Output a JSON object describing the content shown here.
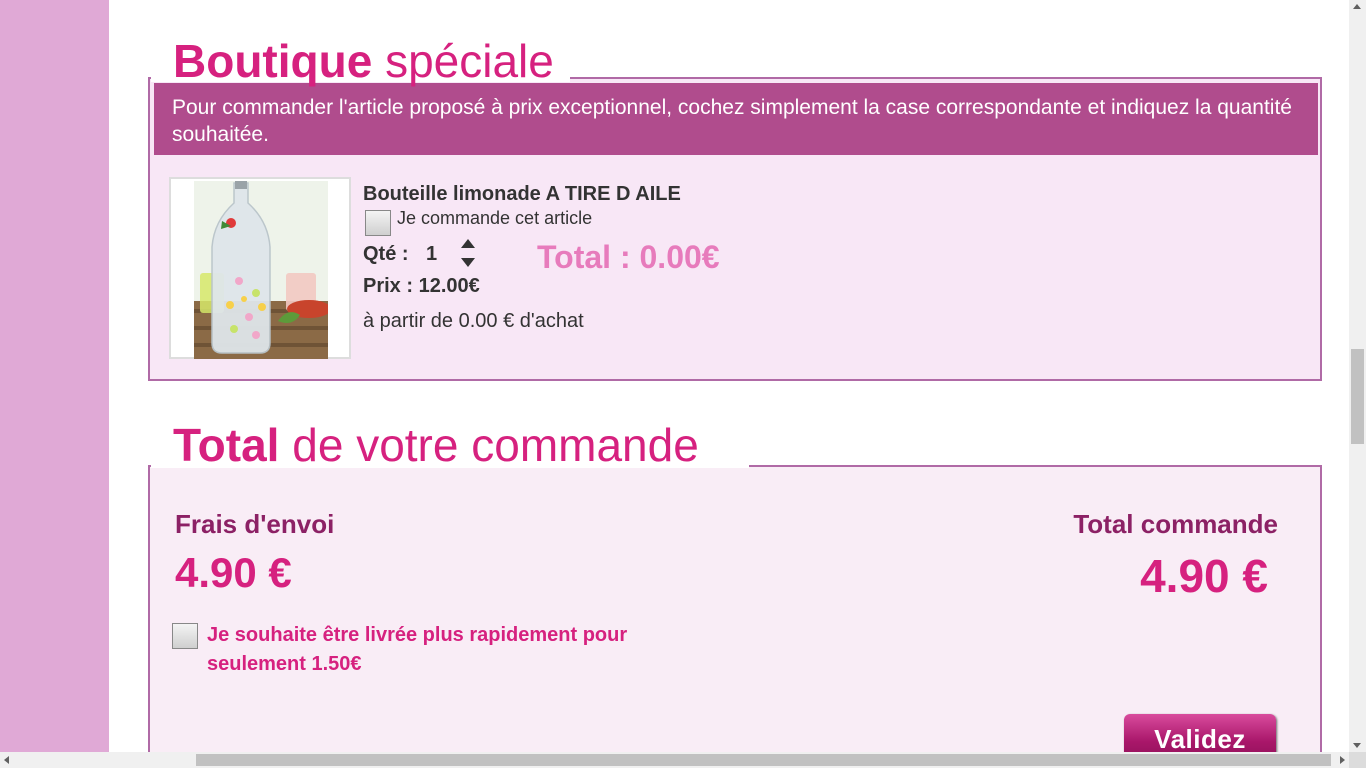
{
  "boutique": {
    "title_bold": "Boutique",
    "title_light": "spéciale",
    "banner_text": "Pour commander l'article proposé à prix exceptionnel, cochez simplement la case correspondante et indiquez la quantité souhaitée.",
    "product": {
      "name": "Bouteille limonade A TIRE D AILE",
      "checkbox_label": "Je commande cet article",
      "checked": false,
      "qty_label": "Qté :",
      "qty_value": "1",
      "line_total": "Total : 0.00€",
      "price": "Prix : 12.00€",
      "min_purchase": "à partir de 0.00 € d'achat",
      "image_icon": "lemonade-bottle-photo"
    }
  },
  "order_total": {
    "title_bold": "Total",
    "title_light": "de votre commande",
    "shipping_label": "Frais d'envoi",
    "shipping_value": "4.90 €",
    "total_label": "Total commande",
    "total_value": "4.90 €",
    "fast_delivery_label": "Je souhaite être livrée plus rapidement pour seulement 1.50€",
    "fast_delivery_checked": false,
    "validate_label": "Validez"
  },
  "colors": {
    "accent": "#d6217f",
    "banner": "#b04c8d",
    "panel_bg": "#f8e7f6",
    "side_band": "#e0a9d6",
    "dark_label": "#8c2165"
  }
}
